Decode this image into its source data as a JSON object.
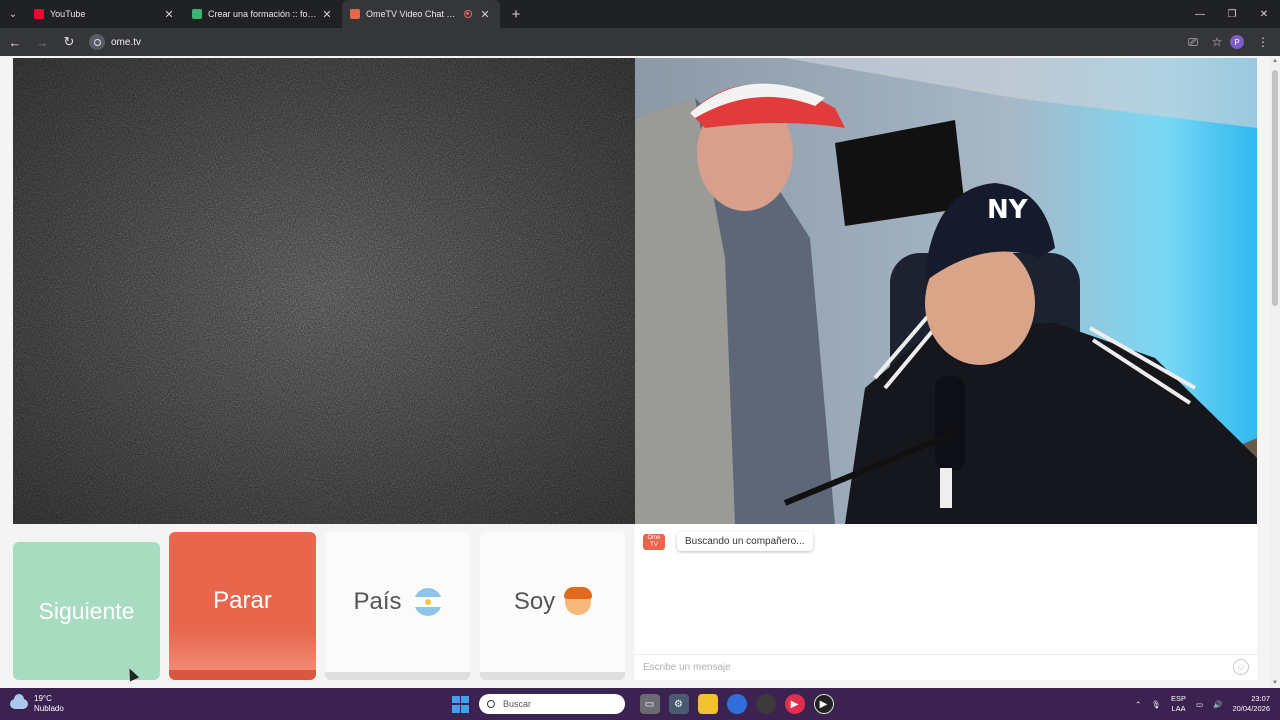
{
  "browser": {
    "tabs": [
      {
        "title": "YouTube",
        "favicon_color": "#ff0033"
      },
      {
        "title": "Crear una formación :: footalist",
        "favicon_color": "#3cb371"
      },
      {
        "title": "OmeTV Video Chat — OmeTV",
        "favicon_color": "#e8664c",
        "active": true
      }
    ],
    "url": "ome.tv"
  },
  "omegle": {
    "buttons": {
      "next": "Siguiente",
      "stop": "Parar",
      "country": "País",
      "soy": "Soy"
    },
    "chat": {
      "logo": "Ome TV",
      "status_message": "Buscando un compañero...",
      "input_placeholder": "Escribe un mensaje"
    }
  },
  "taskbar": {
    "weather_temp": "19°C",
    "weather_desc": "Nublado",
    "search_placeholder": "Buscar",
    "lang_top": "ESP",
    "lang_bottom": "LAA",
    "time": "23:07",
    "date": "20/04/2026"
  },
  "colors": {
    "stop_button": "#e8664c",
    "next_button": "#a8dcc0",
    "taskbar": "#3b2250"
  }
}
